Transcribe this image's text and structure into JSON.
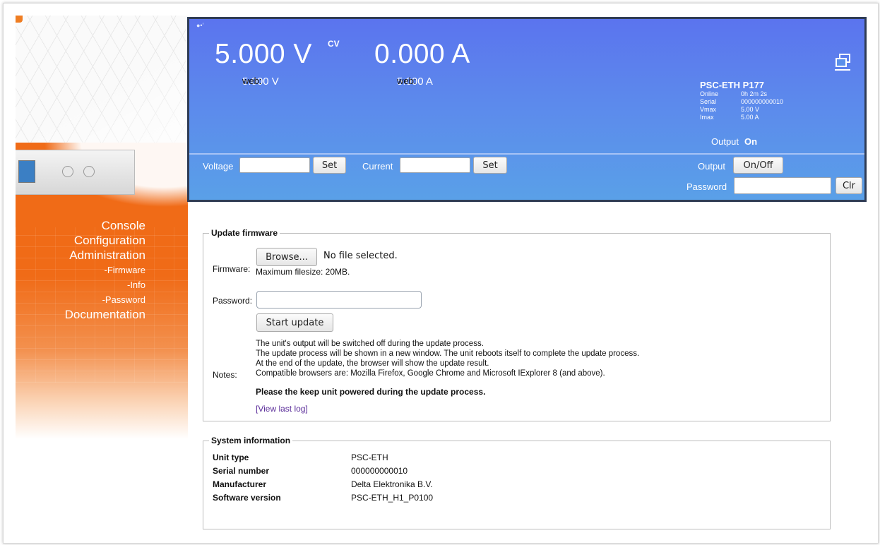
{
  "nav": {
    "console": "Console",
    "configuration": "Configuration",
    "administration": "Administration",
    "firmware": "-Firmware",
    "info": "-Info",
    "password": "-Password",
    "documentation": "Documentation"
  },
  "status": {
    "voltage": "5.000 V",
    "mode": "CV",
    "current": "0.000 A",
    "web_label": "web:",
    "web_voltage": "5.000 V",
    "web_current": "5.000 A",
    "device_name": "PSC-ETH P177",
    "info": [
      {
        "key": "Online",
        "value": "0h 2m 2s"
      },
      {
        "key": "Serial",
        "value": "000000000010"
      },
      {
        "key": "Vmax",
        "value": "5.00 V"
      },
      {
        "key": "Imax",
        "value": "5.00 A"
      }
    ],
    "output_label": "Output",
    "output_state": "On"
  },
  "controls": {
    "voltage_label": "Voltage",
    "current_label": "Current",
    "set_label": "Set",
    "output_label": "Output",
    "onoff_label": "On/Off",
    "password_label": "Password",
    "clr_label": "Clr"
  },
  "firmware": {
    "legend": "Update firmware",
    "firmware_label": "Firmware:",
    "browse_label": "Browse...",
    "file_status": "No file selected.",
    "max_size": "Maximum filesize: 20MB.",
    "password_label": "Password:",
    "start_label": "Start update",
    "notes_label": "Notes:",
    "notes": [
      "The unit's output will be switched off during the update process.",
      "The update process will be shown in a new window. The unit reboots itself to complete the update process.",
      "At the end of the update, the browser will show the update result.",
      "Compatible browsers are: Mozilla Firefox, Google Chrome and Microsoft IExplorer 8 (and above)."
    ],
    "warning": "Please the keep unit powered during the update process.",
    "log_link": "[View last log]"
  },
  "system": {
    "legend": "System information",
    "rows": [
      {
        "key": "Unit type",
        "value": "PSC-ETH"
      },
      {
        "key": "Serial number",
        "value": "000000000010"
      },
      {
        "key": "Manufacturer",
        "value": "Delta Elektronika B.V."
      },
      {
        "key": "Software version",
        "value": "PSC-ETH_H1_P0100"
      }
    ]
  },
  "colors": {
    "panel_blue": "#5b82ec",
    "sidebar_orange": "#f06b17",
    "link_purple": "#5b2d9a"
  }
}
